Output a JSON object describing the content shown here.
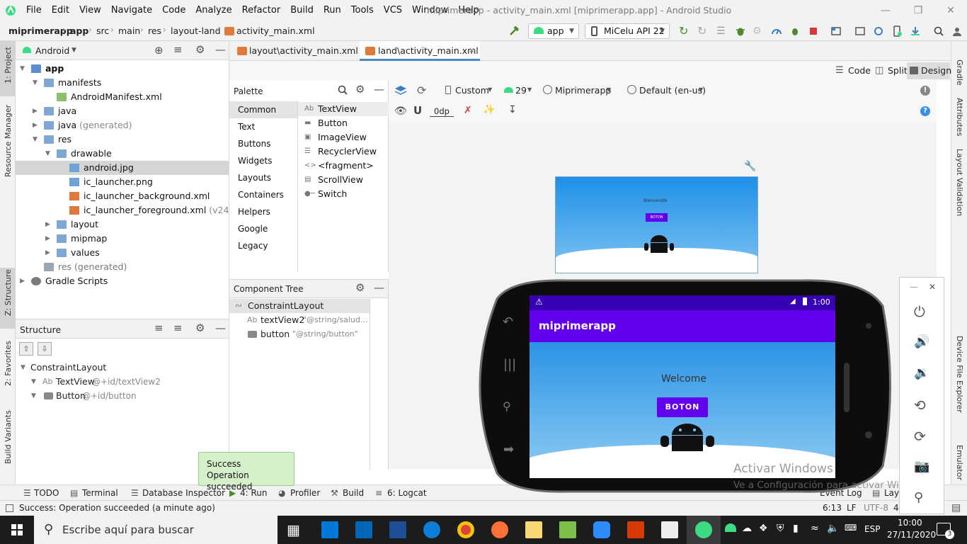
{
  "menu": {
    "items": [
      "File",
      "Edit",
      "View",
      "Navigate",
      "Code",
      "Analyze",
      "Refactor",
      "Build",
      "Run",
      "Tools",
      "VCS",
      "Window",
      "Help"
    ],
    "window_title": "miprimerapp - activity_main.xml [miprimerapp.app] - Android Studio"
  },
  "navbar": {
    "breadcrumbs": [
      "miprimerapp",
      "app",
      "src",
      "main",
      "res",
      "layout-land",
      "activity_main.xml"
    ],
    "run_config": "app",
    "device": "MiCelu API 22"
  },
  "project": {
    "view_mode": "Android",
    "tree": [
      {
        "label": "app",
        "indent": 0,
        "icon": "folder"
      },
      {
        "label": "manifests",
        "indent": 1,
        "icon": "folder"
      },
      {
        "label": "AndroidManifest.xml",
        "indent": 2,
        "icon": "manifest-file"
      },
      {
        "label": "java",
        "indent": 1,
        "icon": "folder"
      },
      {
        "label": "java",
        "suffix": " (generated)",
        "indent": 1,
        "icon": "folder"
      },
      {
        "label": "res",
        "indent": 1,
        "icon": "folder"
      },
      {
        "label": "drawable",
        "indent": 2,
        "icon": "folder"
      },
      {
        "label": "android.jpg",
        "indent": 3,
        "icon": "image-file",
        "selected": true
      },
      {
        "label": "ic_launcher.png",
        "indent": 3,
        "icon": "image-file"
      },
      {
        "label": "ic_launcher_background.xml",
        "indent": 3,
        "icon": "xml-file"
      },
      {
        "label": "ic_launcher_foreground.xml",
        "suffix": " (v24)",
        "indent": 3,
        "icon": "xml-file"
      },
      {
        "label": "layout",
        "indent": 2,
        "icon": "folder"
      },
      {
        "label": "mipmap",
        "indent": 2,
        "icon": "folder"
      },
      {
        "label": "values",
        "indent": 2,
        "icon": "folder"
      },
      {
        "label": "res (generated)",
        "indent": 1,
        "icon": "folder",
        "gray": true
      },
      {
        "label": "Gradle Scripts",
        "indent": 0,
        "icon": "gradle-icon"
      }
    ]
  },
  "structure": {
    "title": "Structure",
    "items": [
      {
        "label": "ConstraintLayout",
        "extra": ""
      },
      {
        "label": "TextView",
        "extra": " @+id/textView2"
      },
      {
        "label": "Button",
        "extra": " @+id/button"
      }
    ]
  },
  "editor_tabs": [
    "layout\\activity_main.xml",
    "land\\activity_main.xml"
  ],
  "view_modes": [
    "Code",
    "Split",
    "Design"
  ],
  "palette": {
    "title": "Palette",
    "categories": [
      "Common",
      "Text",
      "Buttons",
      "Widgets",
      "Layouts",
      "Containers",
      "Helpers",
      "Google",
      "Legacy"
    ],
    "items": [
      "TextView",
      "Button",
      "ImageView",
      "RecyclerView",
      "<fragment>",
      "ScrollView",
      "Switch"
    ]
  },
  "component_tree": {
    "title": "Component Tree",
    "root": "ConstraintLayout",
    "children": [
      {
        "name": "textView2",
        "value": "\"@string/salud...",
        "icon": "Ab"
      },
      {
        "name": "button",
        "value": "\"@string/button\"",
        "icon": "btn"
      }
    ]
  },
  "design_toolbar": {
    "device": "Custom",
    "api": "29",
    "theme": "Miprimerapp",
    "locale": "Default (en-us)",
    "margin": "0dp"
  },
  "preview": {
    "welcome": "Bienvenido",
    "button": "BOTON"
  },
  "emulator": {
    "time": "1:00",
    "app_title": "miprimerapp",
    "welcome": "Welcome",
    "button": "BOTON",
    "appbar_color": "#6200ee"
  },
  "watermark": {
    "line1": "Activar Windows",
    "line2": "Ve a Configuración para activar Windows."
  },
  "right_stripe": [
    "Gradle",
    "Attributes",
    "Layout Validation",
    "Device File Explorer",
    "Emulator"
  ],
  "left_stripe": [
    "1: Project",
    "Resource Manager",
    "Z: Structure",
    "2: Favorites",
    "Build Variants"
  ],
  "bottom_tabs": [
    "TODO",
    "Terminal",
    "Database Inspector",
    "4: Run",
    "Profiler",
    "Build",
    "6: Logcat"
  ],
  "bottom_right_tabs": [
    "Event Log",
    "Layo"
  ],
  "toast": {
    "title": "Success",
    "message": "Operation succeeded"
  },
  "status": {
    "message": "Success: Operation succeeded (a minute ago)",
    "position": "6:13",
    "line_sep": "LF",
    "encoding": "UTF-8",
    "indent": "4"
  },
  "taskbar": {
    "search_placeholder": "Escribe aquí para buscar",
    "lang": "ESP",
    "time": "10:00",
    "date": "27/11/2020",
    "notif_count": "3"
  }
}
